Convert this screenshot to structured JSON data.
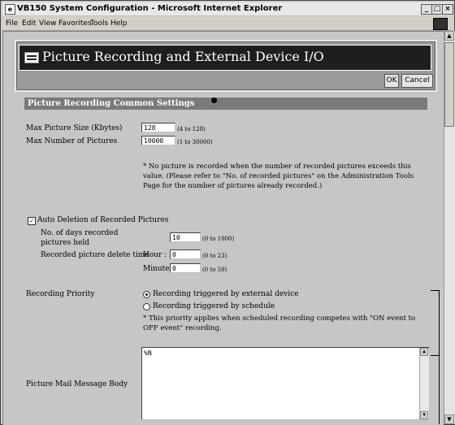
{
  "window": {
    "title": "VB150 System Configuration - Microsoft Internet Explorer",
    "min": "_",
    "max": "□",
    "close": "×"
  },
  "menu": [
    "File",
    "Edit",
    "View",
    "Favorites",
    "Tools",
    "Help"
  ],
  "header": {
    "title": "Picture Recording and External Device I/O",
    "ok_label": "OK",
    "cancel_label": "Cancel"
  },
  "section": {
    "title": "Picture Recording Common Settings"
  },
  "max_picture_size": {
    "label": "Max Picture Size (Kbytes)",
    "value": "128",
    "range": "(4 to 128)"
  },
  "max_pictures": {
    "label": "Max Number of Pictures",
    "value": "10000",
    "range": "(1 to 30000)"
  },
  "note": {
    "text": "* No picture is recorded when the number of recorded pictures exceeds this value. (Please refer to \"No. of recorded pictures\" on the Administration Tools Page for the number of pictures already recorded.)"
  },
  "auto_deletion": {
    "label": "Auto Deletion of Recorded Pictures",
    "checked": true,
    "days_label": "No. of days recorded pictures held",
    "days_value": "10",
    "days_range": "(0 to 1000)",
    "delete_time_label": "Recorded picture delete time",
    "hour_label": "Hour :",
    "hour_value": "0",
    "hour_range": "(0 to 23)",
    "minute_label": "Minute :",
    "minute_value": "0",
    "minute_range": "(0 to 59)"
  },
  "priority": {
    "label": "Recording Priority",
    "option1": "Recording triggered by external device",
    "option2": "Recording triggered by schedule",
    "selected": "option1",
    "note": "* This priority applies when scheduled recording competes with \"ON event to OFF event\" recording."
  },
  "mail": {
    "label": "Picture Mail Message Body",
    "value": "%N"
  }
}
